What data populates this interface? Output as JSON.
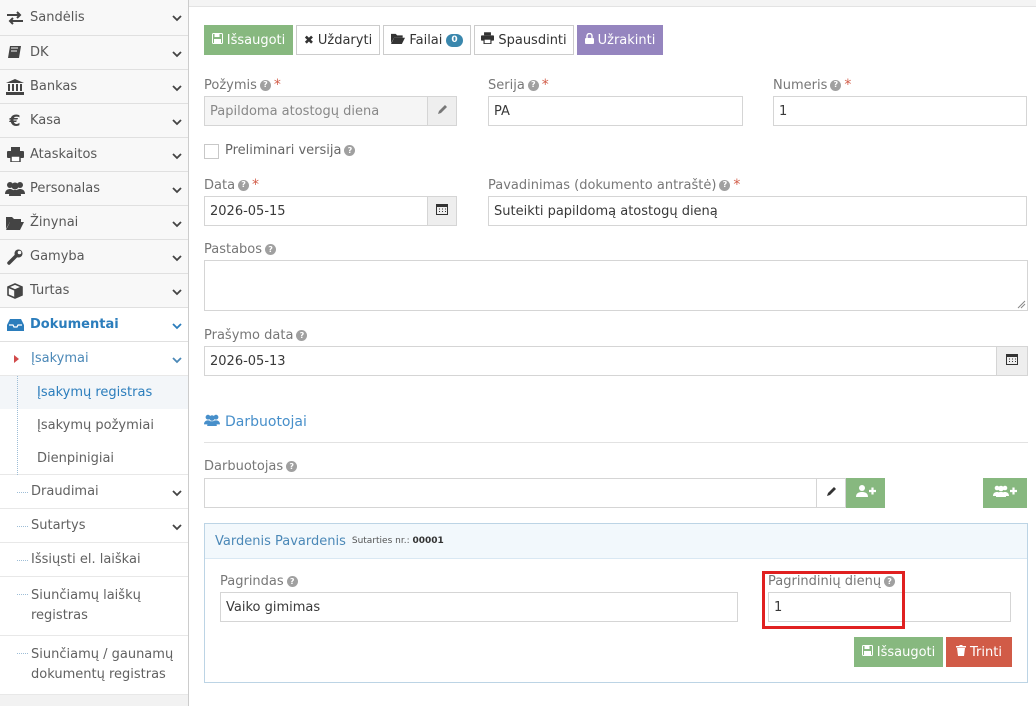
{
  "sidebar": {
    "items": [
      {
        "label": "Sandėlis",
        "icon": "exchange-icon"
      },
      {
        "label": "DK",
        "icon": "book-icon"
      },
      {
        "label": "Bankas",
        "icon": "bank-icon"
      },
      {
        "label": "Kasa",
        "icon": "euro-icon"
      },
      {
        "label": "Ataskaitos",
        "icon": "print-icon"
      },
      {
        "label": "Personalas",
        "icon": "users-icon"
      },
      {
        "label": "Žinynai",
        "icon": "folder-icon"
      },
      {
        "label": "Gamyba",
        "icon": "wrench-icon"
      },
      {
        "label": "Turtas",
        "icon": "cube-icon"
      },
      {
        "label": "Dokumentai",
        "icon": "inbox-icon"
      }
    ],
    "sub": {
      "isakymai": "Įsakymai",
      "registras": "Įsakymų registras",
      "pozymiai": "Įsakymų požymiai",
      "dienpinigiai": "Dienpinigiai",
      "draudimai": "Draudimai",
      "sutartys": "Sutartys",
      "issiusti": "Išsiųsti el. laiškai",
      "siunciamu_laisku": "Siunčiamų laiškų registras",
      "siunciamu_gaunamu": "Siunčiamų / gaunamų dokumentų registras"
    }
  },
  "toolbar": {
    "save": "Išsaugoti",
    "close": "Uždaryti",
    "files": "Failai",
    "files_count": "0",
    "print": "Spausdinti",
    "lock": "Užrakinti"
  },
  "form": {
    "pozymis_label": "Požymis",
    "pozymis_value": "Papildoma atostogų diena",
    "serija_label": "Serija",
    "serija_value": "PA",
    "numeris_label": "Numeris",
    "numeris_value": "1",
    "preliminari_label": "Preliminari versija",
    "data_label": "Data",
    "data_value": "2026-05-15",
    "pavadinimas_label": "Pavadinimas (dokumento antraštė)",
    "pavadinimas_value": "Suteikti papildomą atostogų dieną",
    "pastabos_label": "Pastabos",
    "pastabos_value": "",
    "prasymo_label": "Prašymo data",
    "prasymo_value": "2026-05-13"
  },
  "employees": {
    "section_title": "Darbuotojai",
    "darbuotojas_label": "Darbuotojas",
    "darbuotojas_value": "",
    "panel": {
      "name": "Vardenis Pavardenis",
      "contract_label": "Sutarties nr.:",
      "contract_no": "00001",
      "pagrindas_label": "Pagrindas",
      "pagrindas_value": "Vaiko gimimas",
      "dienu_label": "Pagrindinių dienų",
      "dienu_value": "1",
      "save": "Išsaugoti",
      "delete": "Trinti"
    }
  },
  "colors": {
    "green": "#87b87f",
    "purple": "#9585bf",
    "red": "#d15b47",
    "blue": "#2b7dbc",
    "highlight": "#e02020"
  }
}
